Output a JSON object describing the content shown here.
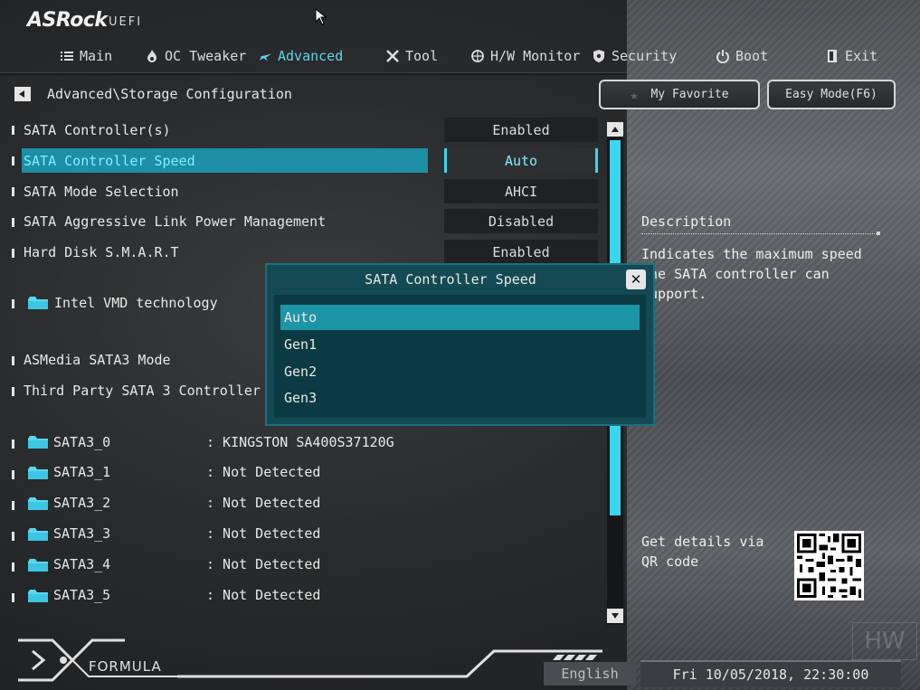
{
  "brand": {
    "logo": "ASRock",
    "uefi": "UEFI"
  },
  "tabs": [
    {
      "label": "Main",
      "icon": "list-icon"
    },
    {
      "label": "OC Tweaker",
      "icon": "flame-icon"
    },
    {
      "label": "Advanced",
      "icon": "star-icon"
    },
    {
      "label": "Tool",
      "icon": "tools-icon"
    },
    {
      "label": "H/W Monitor",
      "icon": "monitor-icon"
    },
    {
      "label": "Security",
      "icon": "shield-icon"
    },
    {
      "label": "Boot",
      "icon": "power-icon"
    },
    {
      "label": "Exit",
      "icon": "exit-icon"
    }
  ],
  "active_tab": "Advanced",
  "breadcrumb": "Advanced\\Storage Configuration",
  "header_buttons": {
    "favorite": "My Favorite",
    "easy_mode": "Easy Mode(F6)"
  },
  "settings": [
    {
      "label": "SATA Controller(s)",
      "value": "Enabled"
    },
    {
      "label": "SATA Controller Speed",
      "value": "Auto"
    },
    {
      "label": "SATA Mode Selection",
      "value": "AHCI"
    },
    {
      "label": "SATA Aggressive Link Power Management",
      "value": "Disabled"
    },
    {
      "label": "Hard Disk S.M.A.R.T",
      "value": "Enabled"
    },
    {
      "label": "Intel VMD technology"
    },
    {
      "label": "ASMedia SATA3 Mode"
    },
    {
      "label": "Third Party SATA 3 Controller"
    }
  ],
  "sata_ports": [
    {
      "name": "SATA3_0",
      "value": ": KINGSTON SA400S37120G"
    },
    {
      "name": "SATA3_1",
      "value": ": Not Detected"
    },
    {
      "name": "SATA3_2",
      "value": ": Not Detected"
    },
    {
      "name": "SATA3_3",
      "value": ": Not Detected"
    },
    {
      "name": "SATA3_4",
      "value": ": Not Detected"
    },
    {
      "name": "SATA3_5",
      "value": ": Not Detected"
    }
  ],
  "popup": {
    "title": "SATA Controller Speed",
    "options": [
      "Auto",
      "Gen1",
      "Gen2",
      "Gen3"
    ],
    "selected": "Auto"
  },
  "description": {
    "title": "Description",
    "text": "Indicates the maximum speed the SATA controller can support.",
    "qr_text": "Get details via QR code"
  },
  "footer": {
    "brand": "FORMULA",
    "language": "English",
    "datetime": "Fri 10/05/2018, 22:30:00",
    "watermark": "HW"
  },
  "colors": {
    "accent": "#3ad6ef",
    "selection": "#1d8ea4",
    "popup_bg": "#144a54"
  }
}
